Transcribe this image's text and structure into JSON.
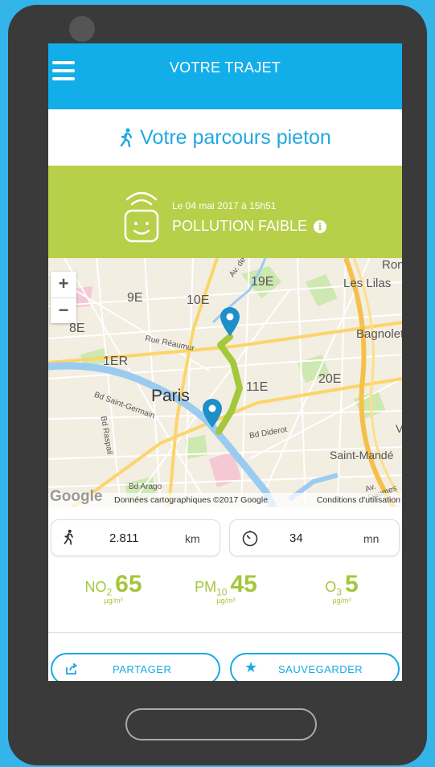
{
  "header": {
    "title": "VOTRE TRAJET",
    "menu_icon": "hamburger-menu-icon"
  },
  "route": {
    "title": "Votre parcours pieton",
    "icon": "pedestrian-icon"
  },
  "pollution": {
    "date": "Le 04 mai 2017 à 15h51",
    "level": "POLLUTION FAIBLE",
    "info": "i",
    "color": "#b8cf4a"
  },
  "map": {
    "zoom_in": "+",
    "zoom_out": "−",
    "labels": {
      "ron": "Ron",
      "lilas": "Les Lilas",
      "arr19": "19E",
      "arr9": "9E",
      "arr10": "10E",
      "arr8": "8E",
      "bagnolet": "Bagnolet",
      "arr1": "1ER",
      "arr11": "11E",
      "arr20": "20E",
      "paris": "Paris",
      "reaumur": "Rue Réaumur",
      "st_germain": "Bd Saint-Germain",
      "raspail": "Bd Raspail",
      "diderot": "Bd Diderot",
      "st_mande": "Saint-Mandé",
      "arago": "Bd Arago",
      "v": "V",
      "av": "Av. de",
      "daumesnil": "Av. Daumes"
    },
    "logo": "Google",
    "data_credit": "Données cartographiques ©2017 Google",
    "terms": "Conditions d'utilisation"
  },
  "stats": {
    "distance": {
      "value": "2.811",
      "unit": "km"
    },
    "duration": {
      "value": "34",
      "unit": "mn"
    }
  },
  "pollutants": [
    {
      "name": "NO",
      "sub": "2",
      "value": "65",
      "unit": "µg/m³"
    },
    {
      "name": "PM",
      "sub": "10",
      "value": "45",
      "unit": "µg/m³"
    },
    {
      "name": "O",
      "sub": "3",
      "value": "5",
      "unit": "µg/m³"
    }
  ],
  "actions": {
    "share": "PARTAGER",
    "save": "SAUVEGARDER"
  },
  "colors": {
    "accent": "#12aeea",
    "green": "#a5c63b"
  }
}
